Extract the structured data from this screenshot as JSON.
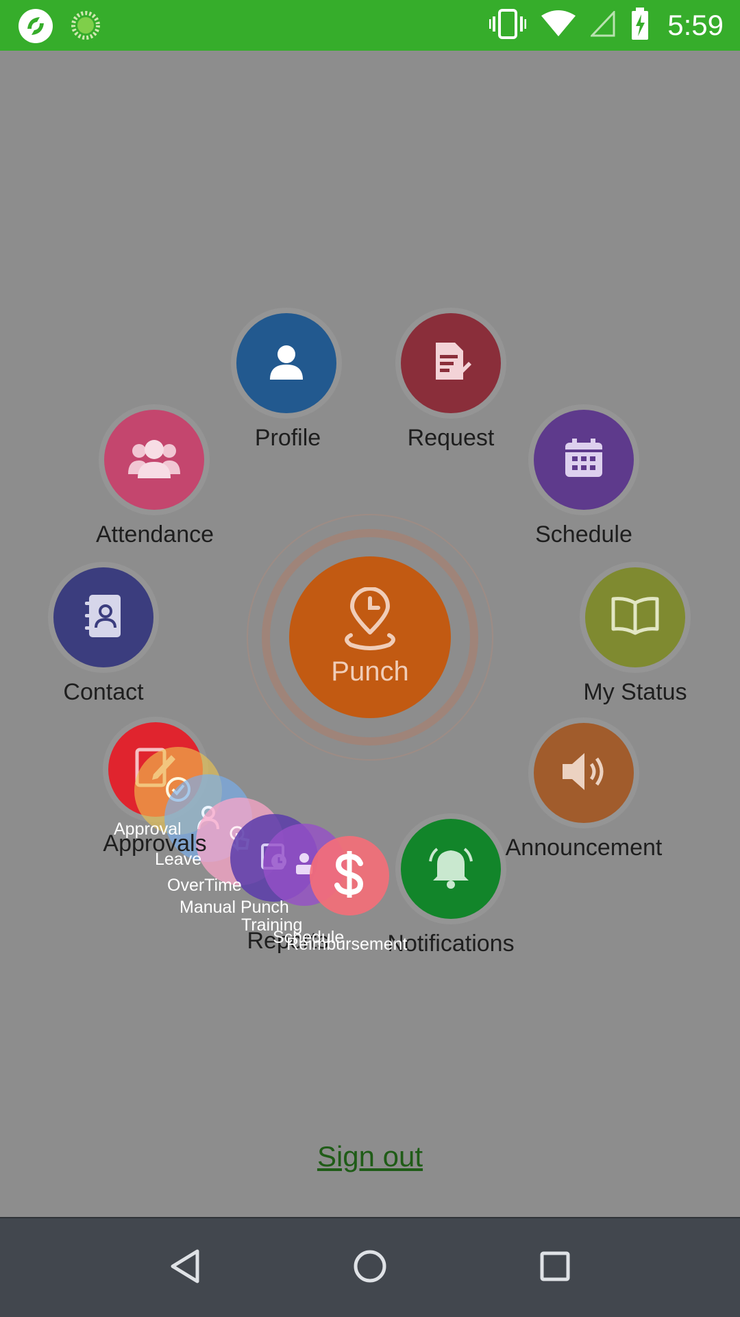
{
  "status_bar": {
    "time": "5:59",
    "icons": [
      "app-logo-icon",
      "loading-spinner-icon",
      "vibrate-icon",
      "wifi-icon",
      "cell-signal-icon",
      "battery-charging-icon"
    ]
  },
  "menu": {
    "profile": "Profile",
    "request": "Request",
    "attendance": "Attendance",
    "schedule": "Schedule",
    "contact": "Contact",
    "my_status": "My Status",
    "approvals": "Approvals",
    "announcement": "Announcement",
    "reports": "Reports",
    "notifications": "Notifications"
  },
  "punch": {
    "label": "Punch"
  },
  "submenu": {
    "approval": "Approval",
    "leave": "Leave",
    "overtime": "OverTime",
    "manual_punch": "Manual Punch",
    "training": "Training",
    "schedule": "Schedule",
    "reimbursement": "Reimbursement"
  },
  "signout": "Sign out",
  "colors": {
    "status_bar": "#36ad2b",
    "background_dim": "#8d8d8d",
    "profile": "#22598f",
    "request": "#8a2e3a",
    "attendance": "#c4466e",
    "schedule": "#5e3a8c",
    "contact": "#3b3d7e",
    "my_status": "#7f8a30",
    "announcement": "#a15c2c",
    "notifications": "#12852a",
    "punch": "#c25a12",
    "nav_bar": "#42474e"
  }
}
